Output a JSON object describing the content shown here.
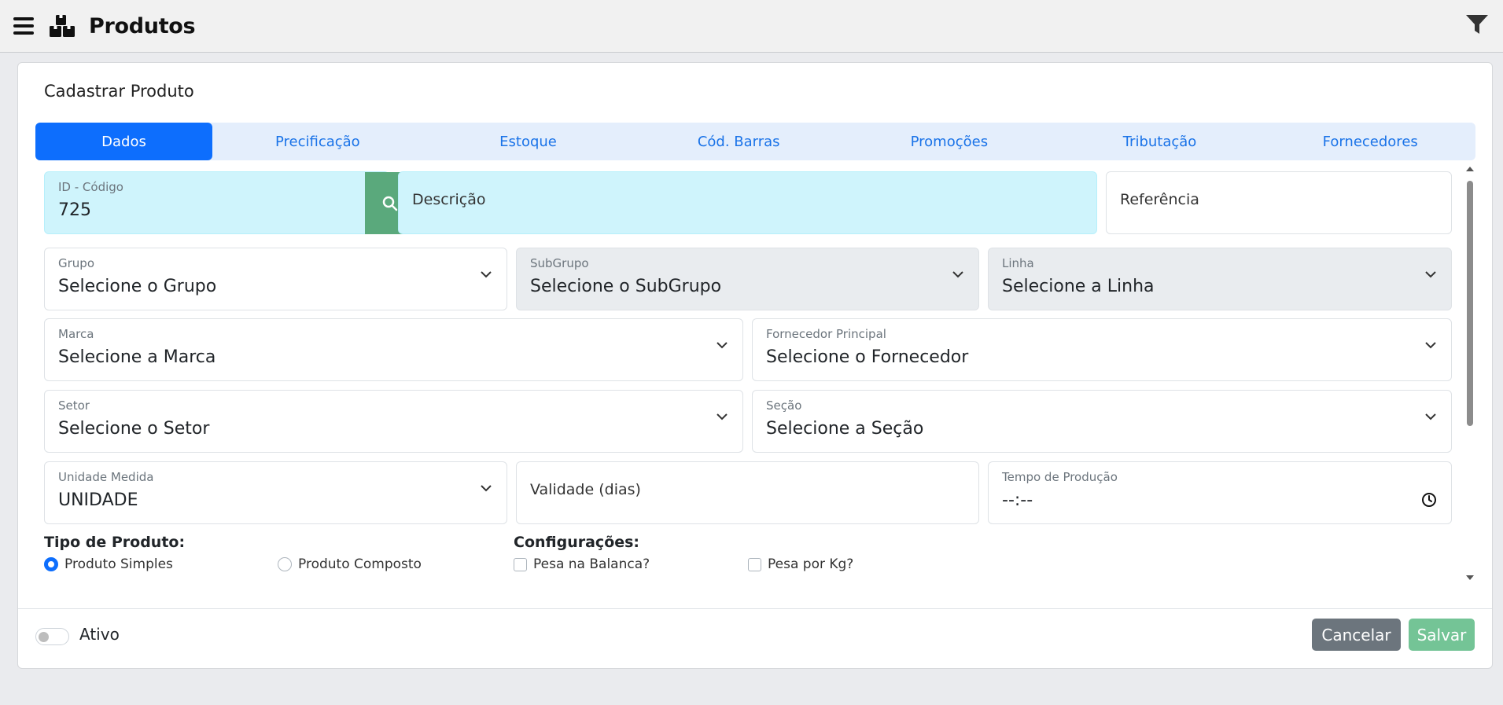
{
  "header": {
    "title": "Produtos",
    "menu_icon": "hamburger-icon",
    "logo_icon": "boxes-icon",
    "filter_icon": "filter-icon"
  },
  "card": {
    "title": "Cadastrar Produto"
  },
  "tabs": [
    {
      "label": "Dados",
      "active": true
    },
    {
      "label": "Precificação"
    },
    {
      "label": "Estoque"
    },
    {
      "label": "Cód. Barras"
    },
    {
      "label": "Promoções"
    },
    {
      "label": "Tributação"
    },
    {
      "label": "Fornecedores"
    }
  ],
  "form": {
    "id_codigo": {
      "label": "ID - Código",
      "value": "725"
    },
    "descricao": {
      "placeholder": "Descrição"
    },
    "referencia": {
      "placeholder": "Referência"
    },
    "grupo": {
      "label": "Grupo",
      "value": "Selecione o Grupo"
    },
    "subgrupo": {
      "label": "SubGrupo",
      "value": "Selecione o SubGrupo"
    },
    "linha": {
      "label": "Linha",
      "value": "Selecione a Linha"
    },
    "marca": {
      "label": "Marca",
      "value": "Selecione a Marca"
    },
    "fornecedor": {
      "label": "Fornecedor Principal",
      "value": "Selecione o Fornecedor"
    },
    "setor": {
      "label": "Setor",
      "value": "Selecione o Setor"
    },
    "secao": {
      "label": "Seção",
      "value": "Selecione a Seção"
    },
    "unidade": {
      "label": "Unidade Medida",
      "value": "UNIDADE"
    },
    "validade": {
      "placeholder": "Validade (dias)"
    },
    "tempo": {
      "label": "Tempo de Produção",
      "value": "--:--"
    },
    "tipo_produto": {
      "label": "Tipo de Produto:",
      "options": [
        {
          "label": "Produto Simples",
          "checked": true
        },
        {
          "label": "Produto Composto",
          "checked": false
        }
      ]
    },
    "configuracoes": {
      "label": "Configurações:",
      "options": [
        {
          "label": "Pesa na Balanca?",
          "checked": false
        },
        {
          "label": "Pesa por Kg?",
          "checked": false
        }
      ]
    }
  },
  "footer": {
    "ativo_label": "Ativo",
    "ativo_on": false,
    "cancel_label": "Cancelar",
    "save_label": "Salvar"
  },
  "colors": {
    "primary": "#0d6efd",
    "cyan_field": "#cff4fc",
    "search_button": "#5aa97c",
    "cancel": "#6c757d",
    "save": "#74c496"
  }
}
